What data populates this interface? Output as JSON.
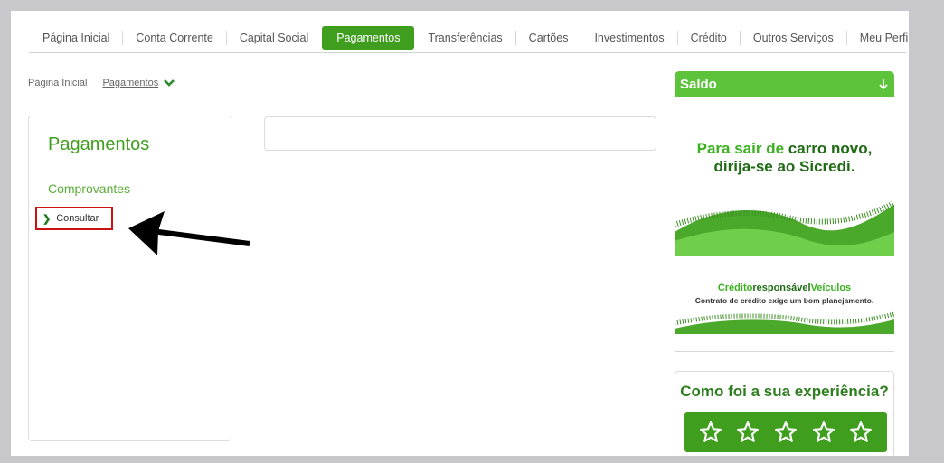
{
  "nav": {
    "items": [
      "Página Inicial",
      "Conta Corrente",
      "Capital Social",
      "Pagamentos",
      "Transferências",
      "Cartões",
      "Investimentos",
      "Crédito",
      "Outros Serviços",
      "Meu Perfil"
    ],
    "active": "Pagamentos"
  },
  "breadcrumb": {
    "home": "Página Inicial",
    "current": "Pagamentos"
  },
  "left_panel": {
    "title": "Pagamentos",
    "section": "Comprovantes",
    "item": "Consultar"
  },
  "right": {
    "saldo_label": "Saldo",
    "banner1": {
      "line1_a": "Para sair de ",
      "line1_b": "carro novo,",
      "line2": "dirija-se ao Sicredi."
    },
    "banner2": {
      "t1_a": "Crédito",
      "t1_b": "responsável",
      "t1_c": "Veículos",
      "t2": "Contrato de crédito exige um bom planejamento."
    },
    "rating_question": "Como foi a sua experiência?",
    "rating_stars": 5
  },
  "colors": {
    "brand_green": "#3f9e1e",
    "light_green": "#5cc33a",
    "highlight_red": "#cc1111"
  },
  "icons": {
    "breadcrumb": "chevron-down-icon",
    "item": "chevron-right-icon",
    "saldo": "arrow-down-icon",
    "star": "star-outline-icon"
  }
}
